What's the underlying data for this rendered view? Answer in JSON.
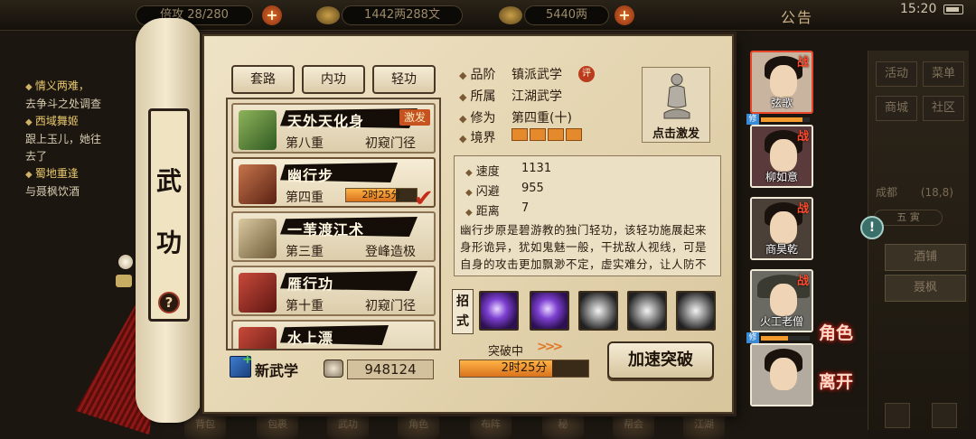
{
  "topbar": {
    "res1": "倍攻 28/280",
    "copper": "1442两288文",
    "silver": "5440两",
    "notice": "公告",
    "time": "15:20"
  },
  "quests": [
    {
      "title": "情义两难，",
      "desc": "去争斗之处调查"
    },
    {
      "title": "西域舞姬",
      "desc": "跟上玉儿，她往"
    },
    {
      "title": "",
      "desc": "去了"
    },
    {
      "title": "蜀地重逢",
      "desc": "与聂枫饮酒"
    }
  ],
  "right_menu": {
    "buttons": [
      "活动",
      "菜单",
      "商城",
      "社区"
    ],
    "area": "成都",
    "area_value": "(18,8)",
    "area_sub": "五 寅",
    "shops": [
      "酒铺",
      "聂枫"
    ]
  },
  "bottom_icons": [
    "背包",
    "包裹",
    "武功",
    "角色",
    "布阵",
    "秘",
    "帮会",
    "江湖",
    "地图"
  ],
  "scroll": {
    "title": [
      "武",
      "功"
    ],
    "help": "?"
  },
  "tabs": [
    "套路",
    "内功",
    "轻功"
  ],
  "skills": [
    {
      "name": "天外天化身",
      "level": "第八重",
      "rank": "初窥门径",
      "tag": "激发"
    },
    {
      "name": "幽行步",
      "level": "第四重",
      "timer": "2时25分",
      "timer_progress": 0.7
    },
    {
      "name": "一苇渡江术",
      "level": "第三重",
      "rank": "登峰造极"
    },
    {
      "name": "雁行功",
      "level": "第十重",
      "rank": "初窥门径"
    },
    {
      "name": "水上漂",
      "level": "",
      "rank": ""
    }
  ],
  "new_skill_label": "新武学",
  "points": "948124",
  "detail": {
    "grade_label": "品阶",
    "grade": "镇派武学",
    "eval_badge": "评",
    "belong_label": "所属",
    "belong": "江湖武学",
    "cultivation_label": "修为",
    "cultivation": "第四重(十)",
    "realm_label": "境界",
    "trigger_label": "点击激发",
    "stats": [
      {
        "label": "速度",
        "value": "1131"
      },
      {
        "label": "闪避",
        "value": "955"
      },
      {
        "label": "距离",
        "value": "7"
      }
    ],
    "description": "幽行步原是碧游教的独门轻功，该轻功施展起来身形诡异，犹如鬼魅一般，干扰敌人视线，可是自身的攻击更加飘渺不定，虚实难分，让人防不胜防。",
    "moves_label": "招式",
    "moves": [
      "purple-slash",
      "purple-strike",
      "grey-whirl",
      "grey-blade",
      "grey-vortex"
    ],
    "breakthrough_label": "突破中",
    "breakthrough_time": "2时25分",
    "breakthrough_progress": 0.72,
    "speed_button": "加速突破"
  },
  "characters": [
    {
      "name": "弦歌",
      "tag": "战",
      "selected": true,
      "level": "修",
      "exp": 0.85,
      "bg": "#c9b4a0"
    },
    {
      "name": "柳如意",
      "tag": "战",
      "selected": false,
      "bg": "#5a3a3a"
    },
    {
      "name": "商昊乾",
      "tag": "战",
      "selected": false,
      "bg": "#4a4038"
    },
    {
      "name": "火工老僧",
      "tag": "战",
      "selected": false,
      "level": "修",
      "exp": 0.55,
      "bg": "#6a6a62"
    },
    {
      "name": "",
      "tag": "",
      "selected": false,
      "bg": "#b3aba0"
    }
  ],
  "side_labels": [
    "角色",
    "离开"
  ],
  "colors": {
    "accent": "#e07726",
    "war": "#ff4a2a",
    "paper": "#e8dbbb",
    "ink": "#140d08"
  }
}
